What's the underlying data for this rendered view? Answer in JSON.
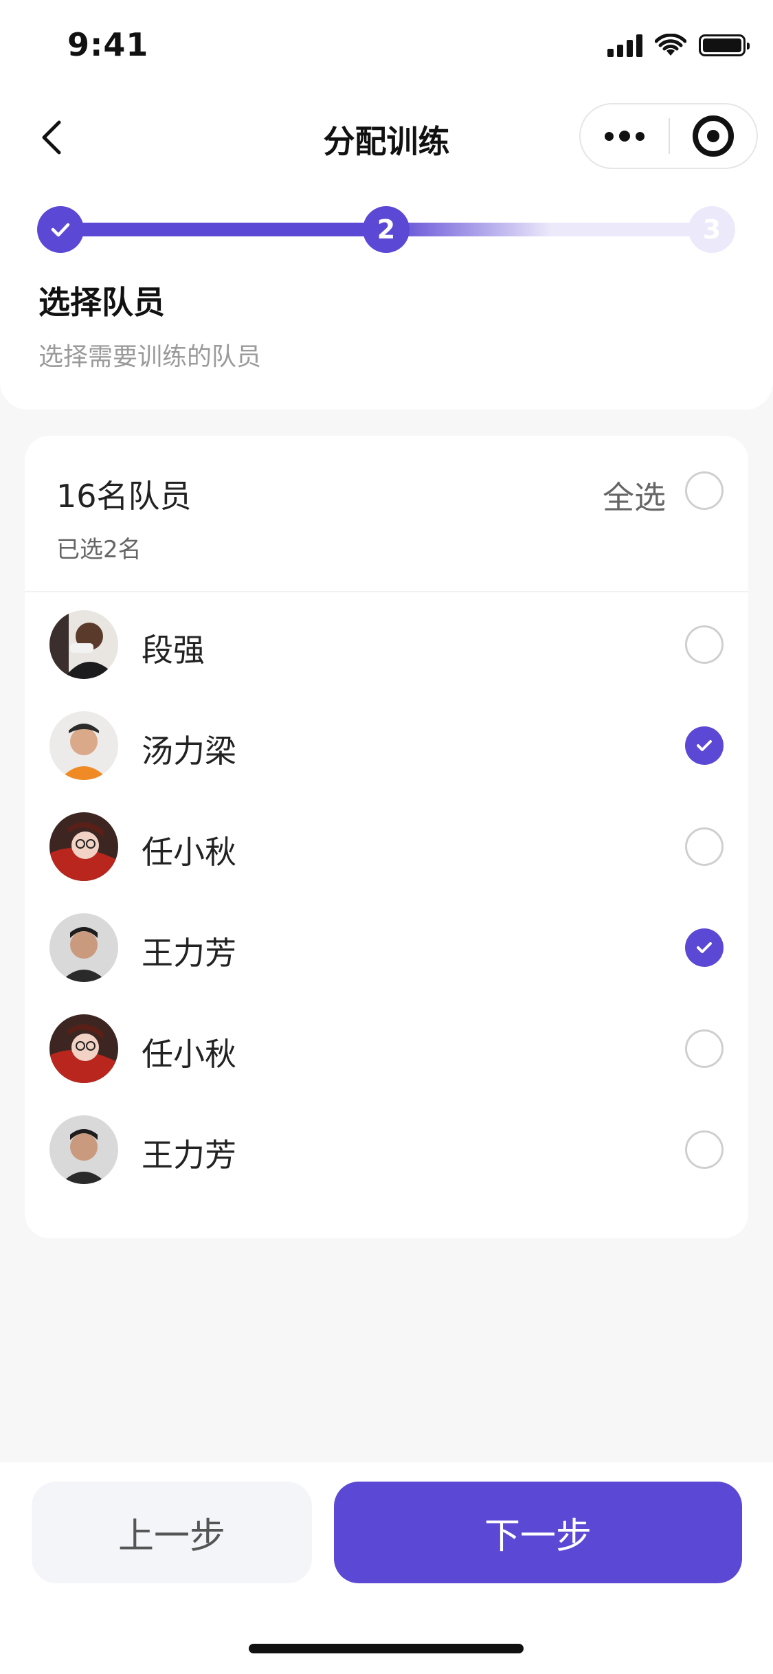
{
  "status_bar": {
    "time": "9:41"
  },
  "nav": {
    "title": "分配训练"
  },
  "stepper": {
    "steps": [
      {
        "state": "done",
        "label": ""
      },
      {
        "state": "current",
        "label": "2"
      },
      {
        "state": "pending",
        "label": "3"
      }
    ]
  },
  "section": {
    "title": "选择队员",
    "subtitle": "选择需要训练的队员"
  },
  "card": {
    "team_count": "16名队员",
    "selected_count": "已选2名",
    "select_all_label": "全选",
    "select_all_checked": false,
    "members": [
      {
        "name": "段强",
        "checked": false
      },
      {
        "name": "汤力梁",
        "checked": true
      },
      {
        "name": "任小秋",
        "checked": false
      },
      {
        "name": "王力芳",
        "checked": true
      },
      {
        "name": "任小秋",
        "checked": false
      },
      {
        "name": "王力芳",
        "checked": false
      }
    ]
  },
  "footer": {
    "prev_label": "上一步",
    "next_label": "下一步"
  },
  "colors": {
    "accent": "#5b48d4",
    "accent_light": "#ece9fb",
    "background": "#f7f7f8"
  }
}
